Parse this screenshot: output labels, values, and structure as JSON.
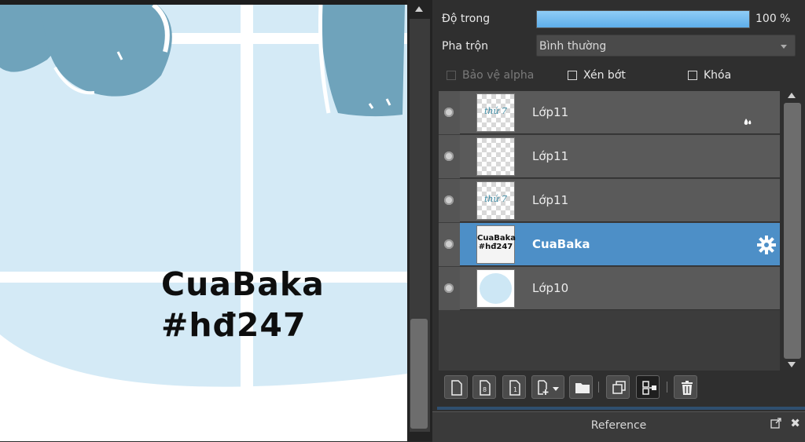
{
  "canvas": {
    "text_line1": "CuaBaka",
    "text_line2": "#hđ247"
  },
  "properties": {
    "opacity_label": "Độ trong",
    "opacity_value": "100 %",
    "opacity_fraction": 1.0,
    "blend_label": "Pha trộn",
    "blend_value": "Bình thường",
    "protect_alpha_label": "Bảo vệ alpha",
    "clip_label": "Xén bớt",
    "lock_label": "Khóa"
  },
  "layers": [
    {
      "name": "Lớp11",
      "thumb_text": "thứ 7",
      "selected": false
    },
    {
      "name": "Lớp11",
      "thumb_text": "",
      "selected": false
    },
    {
      "name": "Lớp11",
      "thumb_text": "thứ 7",
      "selected": false
    },
    {
      "name": "CuaBaka",
      "thumb_text": "CuaBaka #hđ247",
      "selected": true
    },
    {
      "name": "Lớp10",
      "thumb_text": "",
      "selected": false
    }
  ],
  "reference": {
    "title": "Reference",
    "close_glyph": "✖"
  },
  "colors": {
    "accent": "#4d8fc7",
    "opacity_fill": "#6fbcf0",
    "canvas_light_blue": "#d4eaf6",
    "ribbon_blue": "#6fa3bb"
  }
}
